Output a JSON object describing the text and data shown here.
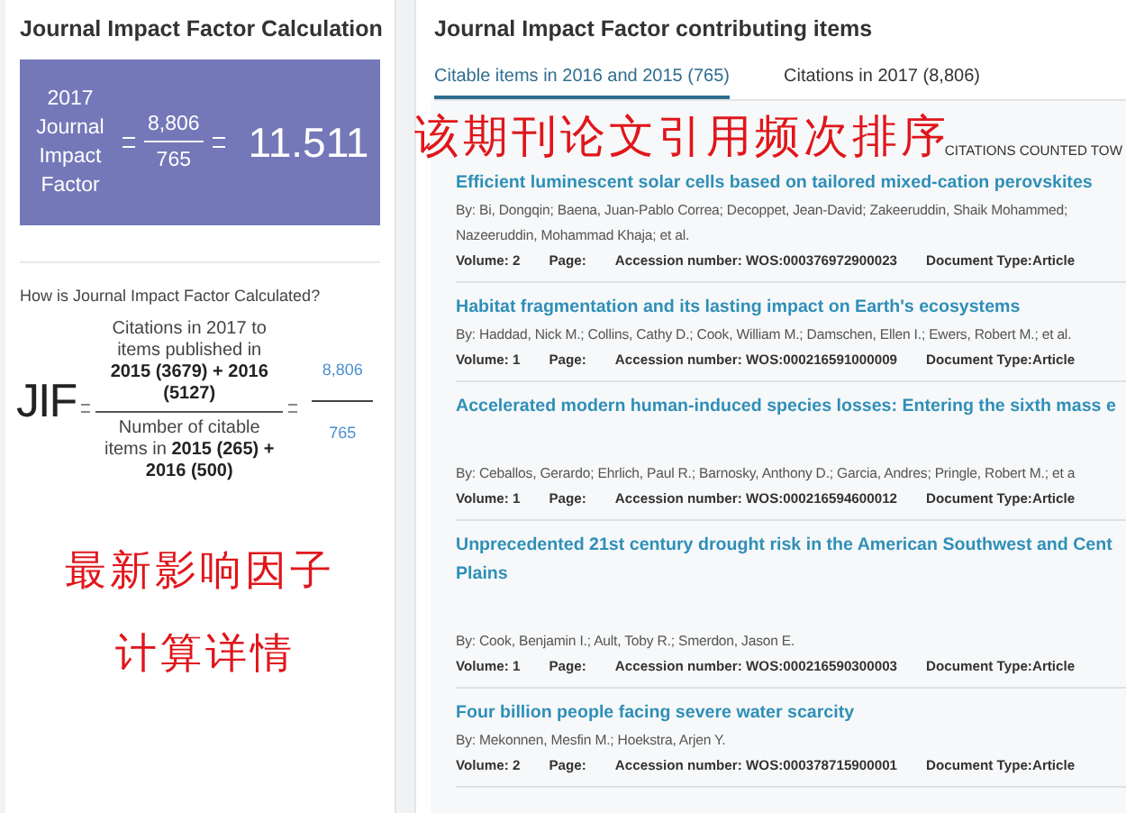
{
  "calculation": {
    "title": "Journal Impact Factor Calculation",
    "label": "2017 Journal Impact Factor",
    "numerator": "8,806",
    "denominator": "765",
    "value": "11.511"
  },
  "explanation": {
    "question": "How is Journal Impact Factor Calculated?",
    "symbol": "JIF",
    "numerator": "Citations in 2017 to items published in **2015 (3679) + 2016 (5127)**",
    "denominator": "Number of citable items in **2015 (265) + 2016 (500)**",
    "result_numerator": "8,806",
    "result_denominator": "765"
  },
  "contributing": {
    "title": "Journal Impact Factor contributing items",
    "tabs": [
      {
        "label": "Citable items in 2016 and 2015 (765)",
        "selected": true
      },
      {
        "label": "Citations in 2017 (8,806)",
        "selected": false
      }
    ],
    "column_header": "CITATIONS COUNTED TOW",
    "items": [
      {
        "kind": "compact",
        "title_lines": [
          "Efficient luminescent solar cells based on tailored mixed-cation perovskites"
        ],
        "author_lines": [
          "By: Bi, Dongqin; Baena, Juan-Pablo Correa; Decoppet, Jean-David; Zakeeruddin, Shaik Mohammed;",
          "Nazeeruddin, Mohammad Khaja; et al."
        ],
        "volume": "Volume: 2",
        "page": "Page:",
        "accession": "Accession number: WOS:000376972900023",
        "doc_type": "Document Type:Article"
      },
      {
        "kind": "compact",
        "title_lines": [
          "Habitat fragmentation and its lasting impact on Earth's ecosystems"
        ],
        "author_lines": [
          "By: Haddad, Nick M.; Collins, Cathy D.; Cook, William M.; Damschen, Ellen I.; Ewers, Robert M.; et al."
        ],
        "volume": "Volume: 1",
        "page": "Page:",
        "accession": "Accession number: WOS:000216591000009",
        "doc_type": "Document Type:Article"
      },
      {
        "kind": "spaced",
        "title_lines": [
          "Accelerated modern human-induced species losses: Entering the sixth mass e"
        ],
        "author_lines": [
          "By: Ceballos, Gerardo; Ehrlich, Paul R.; Barnosky, Anthony D.; Garcia, Andres; Pringle, Robert M.; et a"
        ],
        "volume": "Volume: 1",
        "page": "Page:",
        "accession": "Accession number: WOS:000216594600012",
        "doc_type": "Document Type:Article"
      },
      {
        "kind": "spaced",
        "title_lines": [
          "Unprecedented 21st century drought risk in the American Southwest and Cent",
          "Plains"
        ],
        "author_lines": [
          "By: Cook, Benjamin I.; Ault, Toby R.; Smerdon, Jason E."
        ],
        "volume": "Volume: 1",
        "page": "Page:",
        "accession": "Accession number: WOS:000216590300003",
        "doc_type": "Document Type:Article"
      },
      {
        "kind": "compact",
        "title_lines": [
          "Four billion people facing severe water scarcity"
        ],
        "author_lines": [
          "By: Mekonnen, Mesfin M.; Hoekstra, Arjen Y."
        ],
        "volume": "Volume: 2",
        "page": "Page:",
        "accession": "Accession number: WOS:000378715900001",
        "doc_type": "Document Type:Article"
      }
    ]
  },
  "annotations": [
    {
      "text": "该期刊论文引用频次排序",
      "kind": "top"
    },
    {
      "text": "最新影响因子",
      "kind": "left-1"
    },
    {
      "text": "计算详情",
      "kind": "left-2"
    }
  ]
}
